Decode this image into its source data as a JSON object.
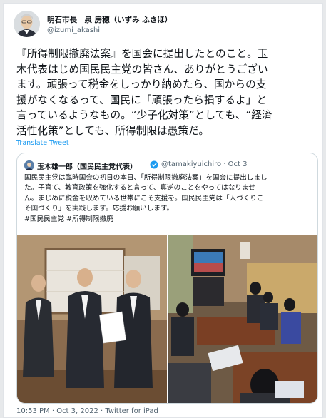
{
  "author": {
    "display_name": "明石市長　泉 房穂（いずみ ふさほ）",
    "handle": "@izumi_akashi"
  },
  "tweet": {
    "lines": [
      "『所得制限撤廃法案』を国会に提出したとのこと。玉",
      "木代表はじめ国民民主党の皆さん、ありがとうござい",
      "ます。頑張って税金をしっかり納めたら、国からの支",
      "援がなくなるって、国民に「頑張ったら損するよ」と",
      "言っているようなもの。“少子化対策”としても、“経済",
      "活性化策”としても、所得制限は愚策だ。"
    ],
    "translate_label": "Translate Tweet"
  },
  "quote": {
    "display_name": "玉木雄一郎（国民民主党代表）",
    "handle_date": "@tamakiyuichiro · Oct 3",
    "lines": [
      "国民民主党は臨時国会の初日の本日、「所得制限撤廃法案」を国会に提出しまし",
      "た。子育て、教育政策を強化すると言って、真逆のことをやってはなりませ",
      "ん。まじめに税金を収めている世帯にこそ支援を。国民民主党は「人づくりこ",
      "そ国づくり」を実践します。応援お願いします。",
      "#国民民主党 #所得制限撤廃"
    ]
  },
  "footer": {
    "meta": "10:53 PM · Oct 3, 2022 · Twitter for iPad"
  },
  "colors": {
    "link": "#1d9bf0",
    "secondary_text": "#536471",
    "border": "#cfd9de"
  }
}
